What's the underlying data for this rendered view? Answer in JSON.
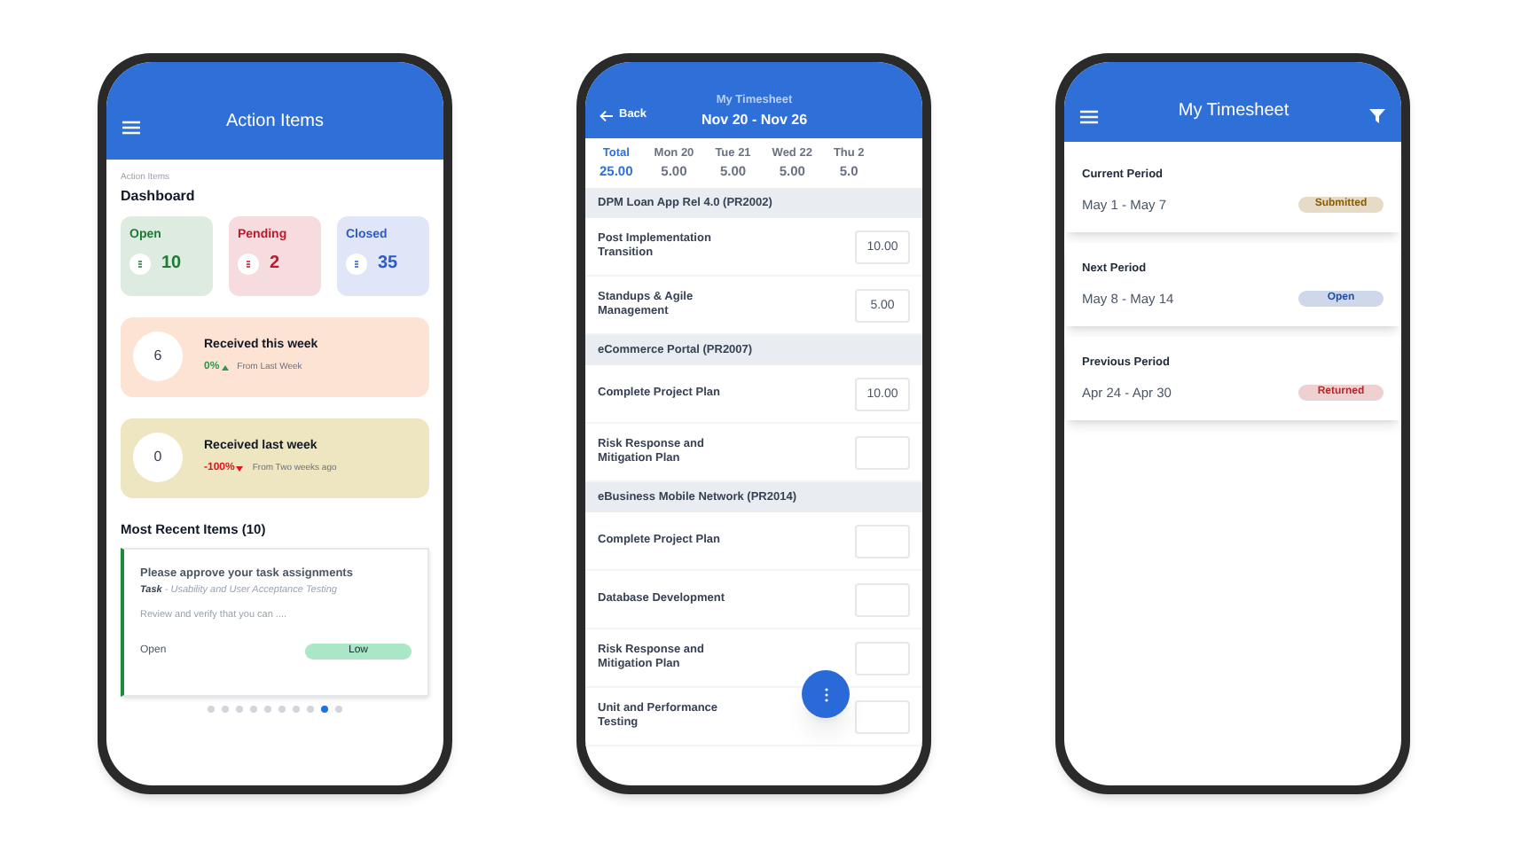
{
  "action_items": {
    "header": {
      "title": "Action Items"
    },
    "breadcrumb": "Action Items",
    "heading": "Dashboard",
    "stats": [
      {
        "label": "Open",
        "value": "10",
        "color": "#1e7a34"
      },
      {
        "label": "Pending",
        "value": "2",
        "color": "#c0182b"
      },
      {
        "label": "Closed",
        "value": "35",
        "color": "#2d5bc9"
      }
    ],
    "weekly": [
      {
        "value": "6",
        "title": "Received this week",
        "change": "0%",
        "rising": true,
        "note": "From Last Week",
        "color": "#fde3d3"
      },
      {
        "value": "0",
        "title": "Received last week",
        "change": "-100%",
        "rising": false,
        "note": "From Two weeks ago",
        "color": "#ede6c0"
      }
    ],
    "recent": {
      "title": "Most Recent Items (10)",
      "card": {
        "title": "Please approve your task assignments",
        "type": "Task",
        "subtitle": " - Usability and User Acceptance Testing",
        "body": "Review and verify that you can ....",
        "status": "Open",
        "priority": "Low"
      }
    },
    "pager": [
      {
        "selected": false
      },
      {
        "selected": false
      },
      {
        "selected": false
      },
      {
        "selected": false
      },
      {
        "selected": false
      },
      {
        "selected": false
      },
      {
        "selected": false
      },
      {
        "selected": false
      },
      {
        "selected": true
      },
      {
        "selected": false
      }
    ]
  },
  "timesheet": {
    "back": "Back",
    "title": "My Timesheet",
    "range": "Nov 20 - Nov 26",
    "days": [
      {
        "label": "Total",
        "total": "25.00",
        "selected": true
      },
      {
        "label": "Mon 20",
        "total": "5.00",
        "selected": false
      },
      {
        "label": "Tue 21",
        "total": "5.00",
        "selected": false
      },
      {
        "label": "Wed 22",
        "total": "5.00",
        "selected": false
      },
      {
        "label": "Thu 2",
        "total": "5.0",
        "selected": false
      }
    ],
    "groups": [
      {
        "name": "DPM Loan App Rel 4.0 (PR2002)",
        "tasks": [
          {
            "name": "Post Implementation Transition",
            "hours": "10.00"
          },
          {
            "name": "Standups & Agile Management",
            "hours": "5.00"
          }
        ]
      },
      {
        "name": "eCommerce Portal (PR2007)",
        "tasks": [
          {
            "name": "Complete Project Plan",
            "hours": "10.00"
          },
          {
            "name": "Risk Response and Mitigation Plan"
          }
        ]
      },
      {
        "name": "eBusiness Mobile Network (PR2014)",
        "tasks": [
          {
            "name": "Complete Project Plan"
          },
          {
            "name": "Database Development"
          },
          {
            "name": "Risk Response and Mitigation Plan"
          },
          {
            "name": "Unit and Performance Testing"
          }
        ]
      }
    ]
  },
  "periods_screen": {
    "title": "My Timesheet",
    "periods": [
      {
        "label": "Current Period",
        "range": "May 1 - May 7",
        "status": "Submitted",
        "color": "#8a5a00"
      },
      {
        "label": "Next Period",
        "range": "May 8 - May 14",
        "status": "Open",
        "color": "#1f4fa0"
      },
      {
        "label": "Previous Period",
        "range": "Apr 24 - Apr 30",
        "status": "Returned",
        "color": "#b02a2a"
      }
    ]
  }
}
